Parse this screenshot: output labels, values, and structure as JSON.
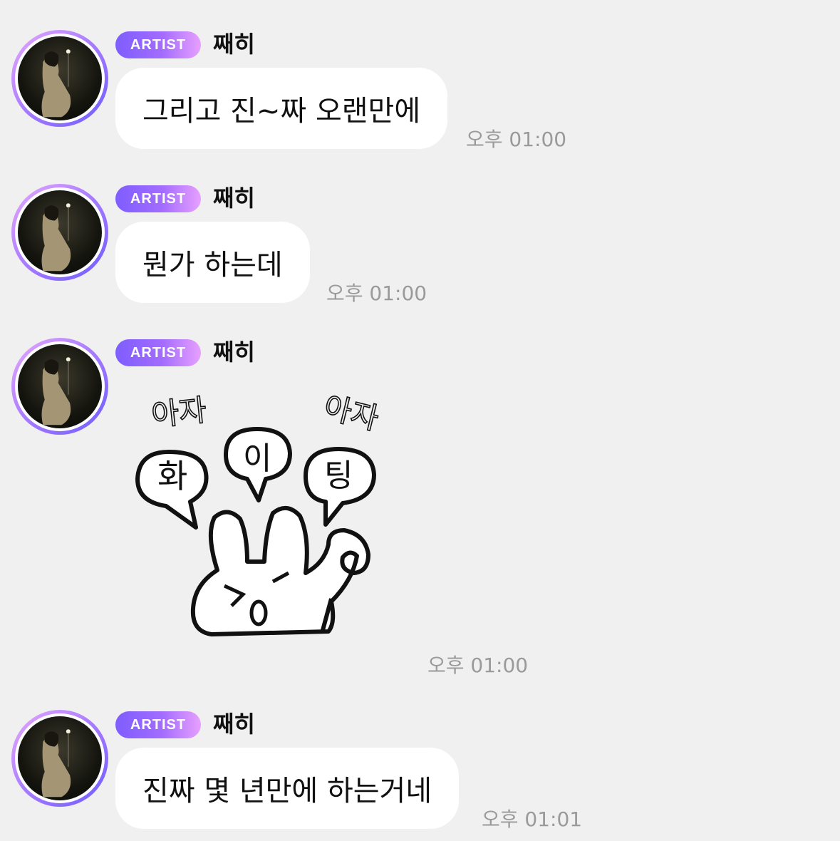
{
  "messages": [
    {
      "badge": "ARTIST",
      "sender": "째히",
      "text": "그리고 진~짜 오랜만에",
      "time": "오후 01:00"
    },
    {
      "badge": "ARTIST",
      "sender": "째히",
      "text": "뭔가 하는데",
      "time": "오후 01:00"
    },
    {
      "badge": "ARTIST",
      "sender": "째히",
      "sticker": {
        "top_left": "아자",
        "top_right": "아자",
        "bubble_1": "화",
        "bubble_2": "이",
        "bubble_3": "팅",
        "icon": "bunny-fighting-sticker"
      },
      "time": "오후 01:00"
    },
    {
      "badge": "ARTIST",
      "sender": "째히",
      "text": "진짜 몇 년만에 하는거네",
      "time": "오후 01:01"
    }
  ],
  "colors": {
    "background": "#f0f0f0",
    "bubble": "#ffffff",
    "badge_gradient_start": "#7e5dff",
    "badge_gradient_end": "#e7a0ff",
    "time": "#9a9a9a"
  }
}
